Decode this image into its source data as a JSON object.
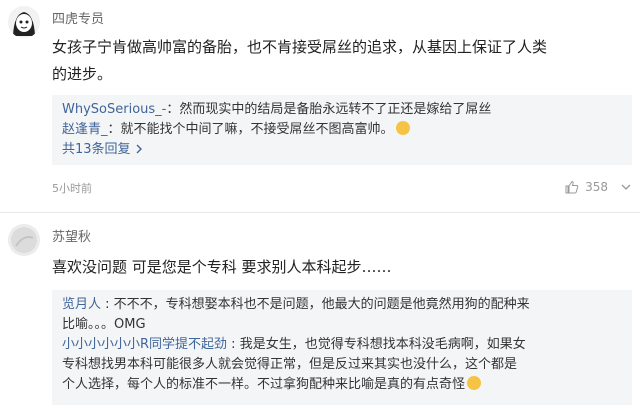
{
  "comments": [
    {
      "username": "四虎专员",
      "body_lines": [
        "女孩子宁肯做高帅富的备胎，也不肯接受屌丝的追求，从基因上保证了人类",
        "的进步。"
      ],
      "replies": [
        {
          "name": "WhySoSerious_-",
          "text": "：然而现实中的结局是备胎永远转不了正还是嫁给了屌丝"
        },
        {
          "name": "赵逢青_",
          "text": "：就不能找个中间了嘛，不接受屌丝不图高富帅。"
        }
      ],
      "more_label": "共13条回复",
      "time": "5小时前",
      "likes": "358"
    },
    {
      "username": "苏望秋",
      "body": "喜欢没问题 可是您是个专科 要求别人本科起步……",
      "replies": [
        {
          "name": "览月人",
          "lines": [
            " : 不不不，专科想娶本科也不是问题，他最大的问题是他竟然用狗的配种来",
            "比喻。。。OMG"
          ]
        },
        {
          "name": "小小小小小小R同学提不起劲",
          "lines": [
            " : 我是女生，也觉得专科想找本科没毛病啊，如果女",
            "专科想找男本科可能很多人就会觉得正常，但是反过来其实也没什么，这个都是",
            "个人选择，每个人的标准不一样。不过拿狗配种来比喻是真的有点奇怪"
          ]
        }
      ]
    }
  ],
  "icons": {
    "like": "thumbs-up-icon",
    "more_chevron": "chevron-right-icon",
    "options": "chevron-down-icon",
    "emoji": "emoji-icon"
  },
  "colors": {
    "link": "#406599",
    "reply_bg": "#f4f5f7",
    "meta": "#999999"
  }
}
